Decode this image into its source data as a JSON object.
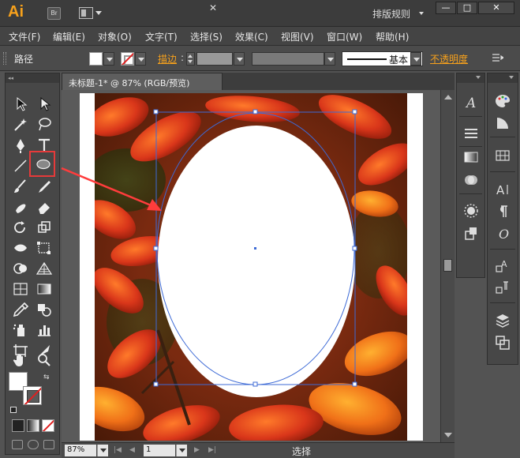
{
  "app": {
    "logo": "Ai",
    "bridge_button": "Br",
    "workspace": "排版规则",
    "window_min": "—",
    "window_max": "□",
    "window_close": "✕"
  },
  "menu": [
    "文件(F)",
    "编辑(E)",
    "对象(O)",
    "文字(T)",
    "选择(S)",
    "效果(C)",
    "视图(V)",
    "窗口(W)",
    "帮助(H)"
  ],
  "control_bar": {
    "selection_label": "路径",
    "stroke_label": "描边",
    "stroke_colon": ":",
    "brush_label": "基本",
    "opacity_label": "不透明度",
    "panel_menu_icon": "hamburger-icon"
  },
  "document": {
    "tab_title": "未标题-1* @ 87% (RGB/预览)",
    "tab_close": "✕"
  },
  "status_bar": {
    "zoom": "87%",
    "page": "1",
    "status_text": "选择"
  },
  "colors": {
    "accent": "#f7a11c",
    "highlight": "#e63a3a",
    "selection": "#3d6ad6"
  },
  "tools": [
    "selection-tool",
    "direct-selection-tool",
    "magic-wand-tool",
    "lasso-tool",
    "pen-tool",
    "type-tool",
    "line-segment-tool",
    "ellipse-tool",
    "paintbrush-tool",
    "blob-brush-tool",
    "shaper-tool",
    "eraser-tool",
    "rotate-tool",
    "scale-tool",
    "width-tool",
    "free-transform-tool",
    "shape-builder-tool",
    "perspective-grid-tool",
    "mesh-tool",
    "gradient-tool",
    "eyedropper-tool",
    "blend-tool",
    "symbol-sprayer-tool",
    "column-graph-tool",
    "artboard-tool",
    "slice-tool",
    "hand-tool",
    "zoom-tool"
  ]
}
